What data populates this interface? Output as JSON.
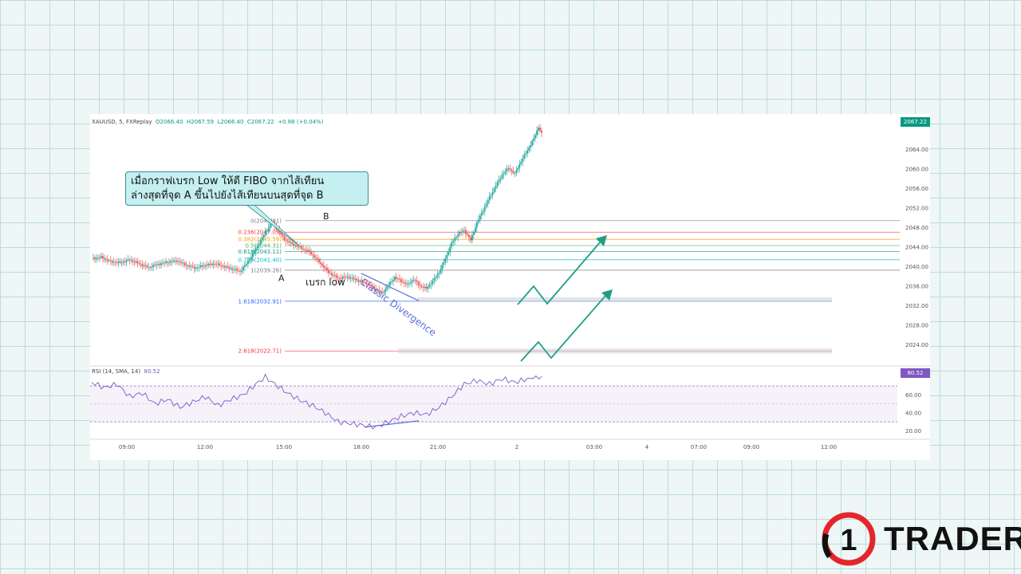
{
  "header": {
    "symbol": "XAUUSD, 5, FXReplay",
    "open": "O2066.40",
    "high": "H2067.59",
    "low": "L2066.40",
    "close": "C2067.22",
    "change": "+0.88 (+0.04%)"
  },
  "current_price": "2067.22",
  "rsi_header": {
    "label": "RSI (14, SMA, 14)",
    "value": "80.52"
  },
  "annotation": {
    "line1": "เมื่อกราฟเบรก Low ให้ตี FIBO จากไส้เทียน",
    "line2": "ล่างสุดที่จุด A ขึ้นไปยังไส้เทียนบนสุดที่จุด B"
  },
  "labels": {
    "point_a": "A",
    "point_b": "B",
    "break_low": "เบรก low",
    "divergence": "Classic Divergence"
  },
  "logo": {
    "number": "1",
    "text": "TRADER"
  },
  "colors": {
    "up": "#26a69a",
    "down": "#ef5350",
    "rsi": "#7e57c2",
    "arrow": "#1f9e86",
    "divergence": "#5b6fd6",
    "logo_red": "#e3262b"
  },
  "chart_data": [
    {
      "type": "candlestick",
      "title": "XAUUSD, 5, FXReplay",
      "x_tick_labels": [
        "09:00",
        "12:00",
        "15:00",
        "18:00",
        "21:00",
        "2",
        "03:00",
        "4",
        "07:00",
        "09:00",
        "12:00"
      ],
      "y_ticks": [
        "2064.00",
        "2060.00",
        "2056.00",
        "2052.00",
        "2048.00",
        "2044.00",
        "2040.00",
        "2036.00",
        "2032.00",
        "2028.00",
        "2024.00"
      ],
      "ylim": [
        2020.3,
        2069.3
      ],
      "price_path": [
        [
          0,
          2041.6
        ],
        [
          6,
          2041.9
        ],
        [
          12,
          2041.0
        ],
        [
          18,
          2040.8
        ],
        [
          24,
          2041.4
        ],
        [
          30,
          2040.6
        ],
        [
          36,
          2039.8
        ],
        [
          42,
          2040.5
        ],
        [
          48,
          2040.9
        ],
        [
          54,
          2041.2
        ],
        [
          60,
          2040.2
        ],
        [
          66,
          2039.7
        ],
        [
          72,
          2040.3
        ],
        [
          78,
          2040.6
        ],
        [
          84,
          2040.0
        ],
        [
          90,
          2039.4
        ],
        [
          94,
          2039.0
        ],
        [
          98,
          2040.6
        ],
        [
          102,
          2042.5
        ],
        [
          106,
          2044.8
        ],
        [
          110,
          2047.0
        ],
        [
          114,
          2049.1
        ],
        [
          118,
          2047.5
        ],
        [
          122,
          2045.6
        ],
        [
          126,
          2044.8
        ],
        [
          132,
          2043.9
        ],
        [
          138,
          2043.0
        ],
        [
          144,
          2041.0
        ],
        [
          150,
          2038.8
        ],
        [
          156,
          2037.6
        ],
        [
          162,
          2037.9
        ],
        [
          168,
          2037.2
        ],
        [
          174,
          2036.6
        ],
        [
          180,
          2035.3
        ],
        [
          184,
          2034.6
        ],
        [
          188,
          2036.2
        ],
        [
          192,
          2037.8
        ],
        [
          196,
          2037.0
        ],
        [
          200,
          2036.3
        ],
        [
          204,
          2037.4
        ],
        [
          208,
          2036.0
        ],
        [
          212,
          2035.5
        ],
        [
          216,
          2037.0
        ],
        [
          220,
          2038.8
        ],
        [
          224,
          2041.6
        ],
        [
          228,
          2044.8
        ],
        [
          232,
          2046.7
        ],
        [
          236,
          2047.4
        ],
        [
          240,
          2045.4
        ],
        [
          244,
          2049.0
        ],
        [
          248,
          2051.6
        ],
        [
          252,
          2054.2
        ],
        [
          256,
          2056.6
        ],
        [
          260,
          2058.8
        ],
        [
          264,
          2060.2
        ],
        [
          268,
          2059.0
        ],
        [
          272,
          2061.6
        ],
        [
          276,
          2063.8
        ],
        [
          280,
          2066.2
        ],
        [
          283,
          2068.6
        ],
        [
          285,
          2067.2
        ]
      ],
      "fibonacci": [
        {
          "label": "0(2049.41)",
          "price": 2049.41,
          "color": "#787b86"
        },
        {
          "label": "0.236(2047.05)",
          "price": 2047.05,
          "color": "#f23645"
        },
        {
          "label": "0.382(2045.59)",
          "price": 2045.59,
          "color": "#ff9800"
        },
        {
          "label": "0.5(2044.31)",
          "price": 2044.31,
          "color": "#4caf50"
        },
        {
          "label": "0.618(2043.11)",
          "price": 2043.11,
          "color": "#089981"
        },
        {
          "label": "0.786(2041.40)",
          "price": 2041.4,
          "color": "#00bcd4"
        },
        {
          "label": "1(2039.26)",
          "price": 2039.26,
          "color": "#787b86"
        },
        {
          "label": "1.618(2032.91)",
          "price": 2032.91,
          "color": "#2962ff"
        },
        {
          "label": "2.618(2022.71)",
          "price": 2022.71,
          "color": "#f23645"
        }
      ]
    },
    {
      "type": "line",
      "title": "RSI (14, SMA, 14)",
      "y_ticks": [
        "60.00",
        "40.00",
        "20.00"
      ],
      "ylim": [
        14,
        87
      ],
      "last_value": 80.52,
      "rsi_path": [
        [
          0,
          74
        ],
        [
          8,
          68
        ],
        [
          16,
          72
        ],
        [
          24,
          58
        ],
        [
          32,
          62
        ],
        [
          40,
          50
        ],
        [
          48,
          55
        ],
        [
          56,
          46
        ],
        [
          64,
          52
        ],
        [
          72,
          58
        ],
        [
          80,
          48
        ],
        [
          88,
          55
        ],
        [
          96,
          60
        ],
        [
          104,
          72
        ],
        [
          110,
          80
        ],
        [
          116,
          72
        ],
        [
          124,
          62
        ],
        [
          132,
          54
        ],
        [
          140,
          48
        ],
        [
          148,
          40
        ],
        [
          156,
          30
        ],
        [
          164,
          28
        ],
        [
          172,
          26
        ],
        [
          180,
          24
        ],
        [
          188,
          30
        ],
        [
          196,
          36
        ],
        [
          204,
          40
        ],
        [
          212,
          38
        ],
        [
          220,
          46
        ],
        [
          228,
          58
        ],
        [
          236,
          72
        ],
        [
          244,
          76
        ],
        [
          252,
          72
        ],
        [
          260,
          78
        ],
        [
          268,
          74
        ],
        [
          276,
          78
        ],
        [
          285,
          80.52
        ]
      ]
    }
  ]
}
